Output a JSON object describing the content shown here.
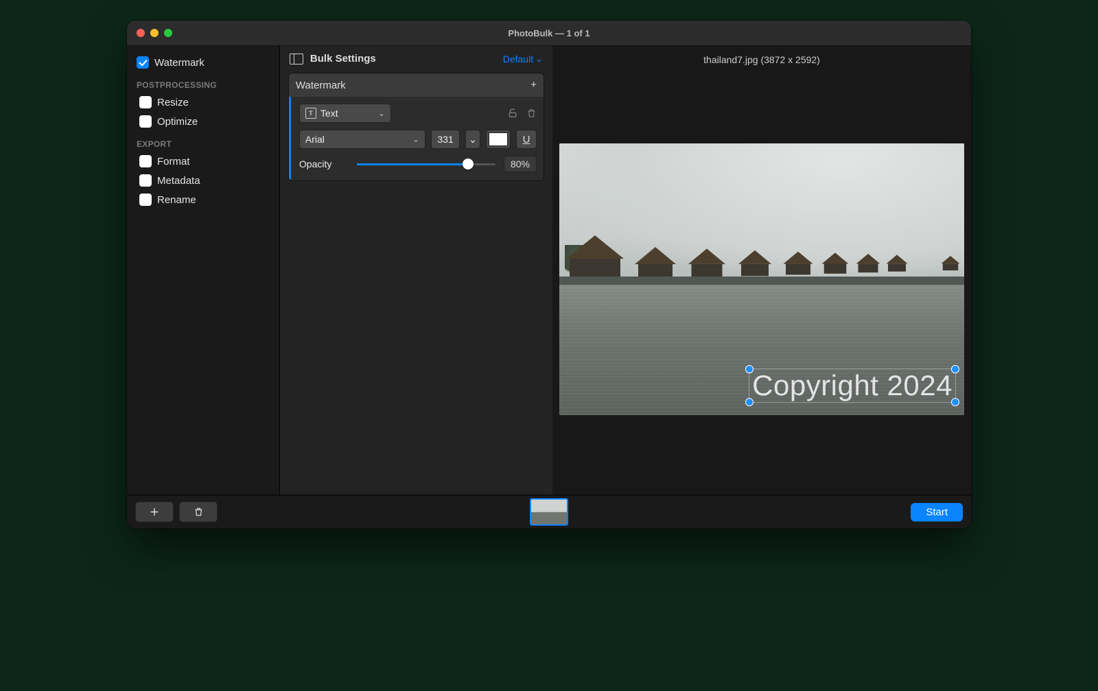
{
  "window": {
    "title": "PhotoBulk — 1 of 1"
  },
  "sidebar": {
    "watermark": {
      "label": "Watermark",
      "checked": true
    },
    "groups": {
      "postprocessing": {
        "label": "POSTPROCESSING",
        "items": [
          {
            "label": "Resize",
            "checked": false
          },
          {
            "label": "Optimize",
            "checked": false
          }
        ]
      },
      "export": {
        "label": "EXPORT",
        "items": [
          {
            "label": "Format",
            "checked": false
          },
          {
            "label": "Metadata",
            "checked": false
          },
          {
            "label": "Rename",
            "checked": false
          }
        ]
      }
    }
  },
  "settings": {
    "title": "Bulk Settings",
    "preset": "Default",
    "watermark": {
      "header": "Watermark",
      "type": "Text",
      "font": "Arial",
      "size": "331",
      "color": "#ffffff",
      "opacity_label": "Opacity",
      "opacity_value": "80%",
      "opacity_pct": 80
    }
  },
  "preview": {
    "filename": "thailand7.jpg (3872 x 2592)",
    "watermark_text": "Copyright 2024"
  },
  "footer": {
    "start": "Start"
  }
}
